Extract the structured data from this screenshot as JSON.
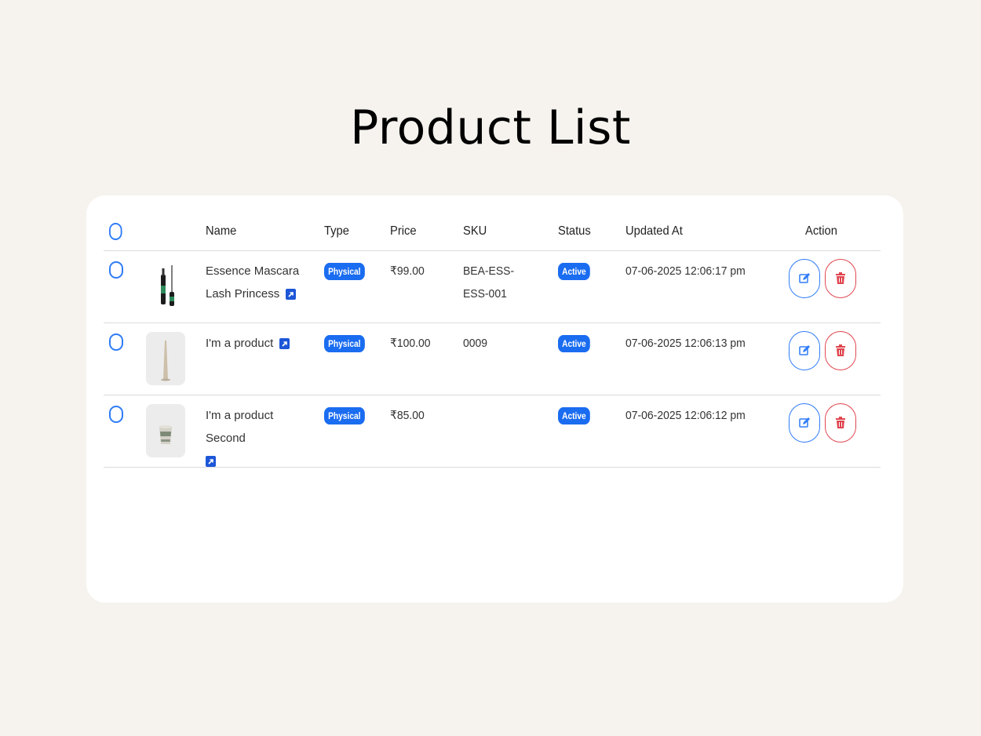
{
  "page": {
    "title": "Product List"
  },
  "table": {
    "headers": {
      "name": "Name",
      "type": "Type",
      "price": "Price",
      "sku": "SKU",
      "status": "Status",
      "updated_at": "Updated At",
      "action": "Action"
    },
    "rows": [
      {
        "name": "Essence Mascara Lash Princess",
        "image": "mascara-image",
        "type": "Physical",
        "price": "₹99.00",
        "sku": "BEA-ESS-ESS-001",
        "status": "Active",
        "updated_at": "07-06-2025 12:06:17 pm"
      },
      {
        "name": "I'm a product",
        "image": "tapered-stick-image",
        "type": "Physical",
        "price": "₹100.00",
        "sku": "0009",
        "status": "Active",
        "updated_at": "07-06-2025 12:06:13 pm"
      },
      {
        "name": "I'm a product Second",
        "image": "cup-image",
        "type": "Physical",
        "price": "₹85.00",
        "sku": "",
        "status": "Active",
        "updated_at": "07-06-2025 12:06:12 pm"
      }
    ],
    "icons": {
      "link": "external-link-icon",
      "edit": "edit-icon",
      "delete": "trash-icon"
    }
  },
  "colors": {
    "accent": "#1a6cf0",
    "danger": "#e0454f",
    "background": "#f6f3ee",
    "card": "#ffffff"
  }
}
